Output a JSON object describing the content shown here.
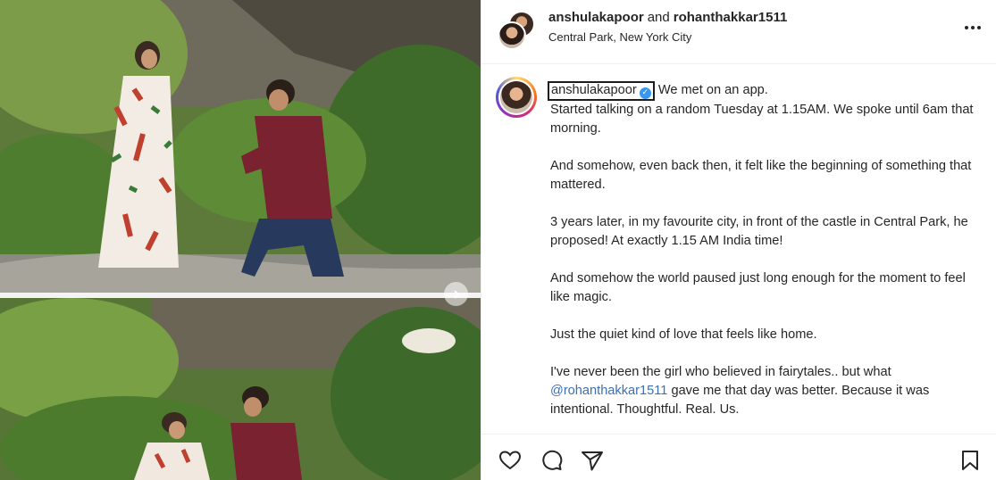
{
  "header": {
    "user1": "anshulakapoor",
    "and": "and",
    "user2": "rohanthakkar1511",
    "location": "Central Park, New York City"
  },
  "caption": {
    "username": "anshulakapoor",
    "line1_suffix": "We met on an app.",
    "p1_rest": "Started talking on a random Tuesday at 1.15AM. We spoke until 6am that morning.",
    "p2": "And somehow, even back then, it felt like the beginning of something that mattered.",
    "p3": "3 years later, in my favourite city, in front of the castle in Central Park, he proposed! At exactly 1.15 AM India time!",
    "p4": "And somehow the world paused just long enough for the moment to feel like magic.",
    "p5": "Just the quiet kind of love that feels like home.",
    "p6_a": "I've never been the girl who believed in fairytales.. but what",
    "p6_mention": "@rohanthakkar1511",
    "p6_b": "gave me that day was better. Because it was intentional. Thoughtful. Real. Us."
  },
  "icons": [
    "heart-icon",
    "comment-icon",
    "share-icon",
    "bookmark-icon",
    "more-icon",
    "verified-icon",
    "chevron-right-icon"
  ],
  "colors": {
    "mention": "#3d6fb3",
    "verified": "#3897f0",
    "text": "#262626"
  }
}
